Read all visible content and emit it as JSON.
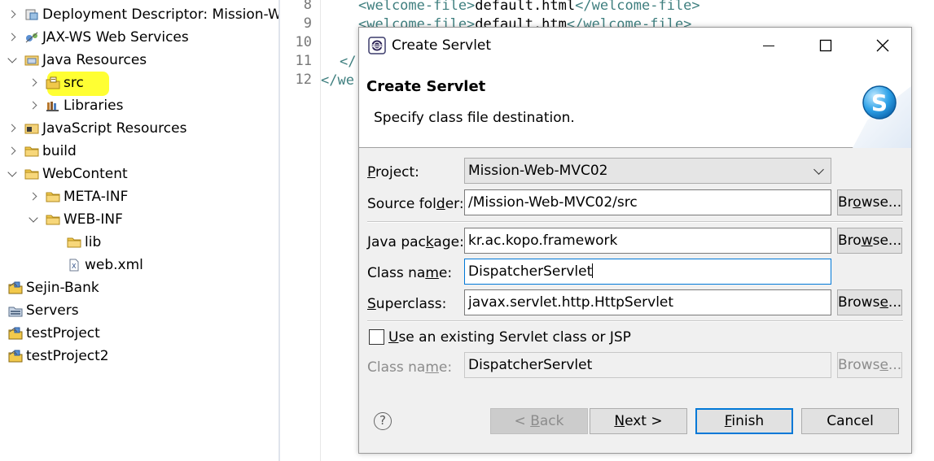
{
  "explorer": {
    "items": [
      {
        "label": "Deployment Descriptor: Mission-W",
        "icon": "deployment-descriptor-icon",
        "twisty": "closed"
      },
      {
        "label": "JAX-WS Web Services",
        "icon": "web-services-icon",
        "twisty": "closed"
      },
      {
        "label": "Java Resources",
        "icon": "java-resources-icon",
        "twisty": "open"
      },
      {
        "label": "src",
        "icon": "source-folder-icon",
        "twisty": "closed",
        "highlighted": true
      },
      {
        "label": "Libraries",
        "icon": "libraries-icon",
        "twisty": "closed"
      },
      {
        "label": "JavaScript Resources",
        "icon": "javascript-resources-icon",
        "twisty": "closed"
      },
      {
        "label": "build",
        "icon": "folder-icon",
        "twisty": "closed"
      },
      {
        "label": "WebContent",
        "icon": "folder-icon",
        "twisty": "open"
      },
      {
        "label": "META-INF",
        "icon": "folder-icon",
        "twisty": "closed"
      },
      {
        "label": "WEB-INF",
        "icon": "folder-icon",
        "twisty": "open"
      },
      {
        "label": "lib",
        "icon": "folder-icon",
        "twisty": "none"
      },
      {
        "label": "web.xml",
        "icon": "xml-file-icon",
        "twisty": "none"
      },
      {
        "label": "Sejin-Bank",
        "icon": "project-icon",
        "twisty": "none"
      },
      {
        "label": "Servers",
        "icon": "servers-folder-icon",
        "twisty": "none"
      },
      {
        "label": "testProject",
        "icon": "project-icon",
        "twisty": "none"
      },
      {
        "label": "testProject2",
        "icon": "project-icon",
        "twisty": "none"
      }
    ],
    "highlight_color": "#ffff33"
  },
  "editor": {
    "lines": [
      {
        "num": "8",
        "open": "<welcome-file>",
        "text": "default.html",
        "close": "</welcome-file>"
      },
      {
        "num": "9",
        "open": "<welcome-file>",
        "text": "default.htm",
        "close": "</welcome-file>"
      },
      {
        "num": "10",
        "open": "",
        "text": "",
        "close": ""
      },
      {
        "num": "11",
        "open": "</",
        "text": "",
        "close": ""
      },
      {
        "num": "12",
        "open": "</we",
        "text": "",
        "close": ""
      }
    ],
    "tag_color": "#3f7f7f"
  },
  "dialog": {
    "window_title": "Create Servlet",
    "banner_title": "Create Servlet",
    "banner_description": "Specify class file destination.",
    "project": {
      "label_u": "P",
      "label_rest": "roject:",
      "value": "Mission-Web-MVC02"
    },
    "source_folder": {
      "label_pre": "Source fol",
      "label_u": "d",
      "label_post": "er:",
      "value": "/Mission-Web-MVC02/src",
      "browse_pre": "Br",
      "browse_u": "o",
      "browse_post": "wse..."
    },
    "java_package": {
      "label_pre": "Java pac",
      "label_u": "k",
      "label_post": "age:",
      "value": "kr.ac.kopo.framework",
      "browse_pre": "Bro",
      "browse_u": "w",
      "browse_post": "se..."
    },
    "class_name": {
      "label_pre": "Class na",
      "label_u": "m",
      "label_post": "e:",
      "value": "DispatcherServlet"
    },
    "superclass": {
      "label_u": "S",
      "label_rest": "uperclass:",
      "value": "javax.servlet.http.HttpServlet",
      "browse_pre": "Brows",
      "browse_u": "e",
      "browse_post": "..."
    },
    "existing_checkbox": {
      "label_u": "U",
      "label_rest": "se an existing Servlet class or JSP",
      "checked": false
    },
    "existing_class_name": {
      "label_pre": "Class na",
      "label_u": "m",
      "label_post": "e:",
      "value": "DispatcherServlet",
      "browse_pre": "Brows",
      "browse_u": "e",
      "browse_post": "..."
    },
    "buttons": {
      "help": "?",
      "back_pre": "< ",
      "back_u": "B",
      "back_post": "ack",
      "next_u": "N",
      "next_post": "ext >",
      "finish_u": "F",
      "finish_post": "inish",
      "cancel": "Cancel"
    },
    "accent_color": "#0078d7"
  }
}
